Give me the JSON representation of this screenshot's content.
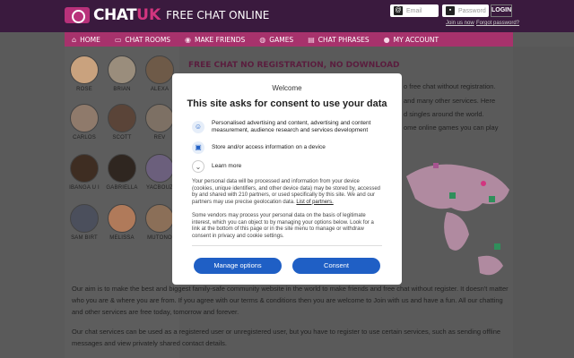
{
  "header": {
    "logo_chat": "CHAT",
    "logo_uk": "UK",
    "logo_tagline": "FREE CHAT ONLINE",
    "email_placeholder": "Email",
    "password_placeholder": "Password",
    "login_label": "LOGIN",
    "join_link": "Join us now",
    "forgot_link": "Forgot password?"
  },
  "nav": {
    "items": [
      {
        "label": "HOME",
        "icon": "home-icon"
      },
      {
        "label": "CHAT ROOMS",
        "icon": "chat-icon"
      },
      {
        "label": "MAKE FRIENDS",
        "icon": "friends-icon"
      },
      {
        "label": "GAMES",
        "icon": "gamepad-icon"
      },
      {
        "label": "CHAT PHRASES",
        "icon": "book-icon"
      },
      {
        "label": "MY ACCOUNT",
        "icon": "user-icon"
      }
    ]
  },
  "friends": [
    {
      "name": "ROSE",
      "color": "#c9a27e"
    },
    {
      "name": "BRIAN",
      "color": "#9a8d7c"
    },
    {
      "name": "ALEXA",
      "color": "#6e5a48"
    },
    {
      "name": "CARLOS",
      "color": "#8f7a6b"
    },
    {
      "name": "SCOTT",
      "color": "#5a4438"
    },
    {
      "name": "REV",
      "color": "#7d7064"
    },
    {
      "name": "IBANGA U I",
      "color": "#3e2d22"
    },
    {
      "name": "GABRIELLA",
      "color": "#2f2620"
    },
    {
      "name": "YACBOUZ",
      "color": "#6b5f7c"
    },
    {
      "name": "SAM BIRT",
      "color": "#4b4f5c"
    },
    {
      "name": "MELISSA",
      "color": "#b07a5a"
    },
    {
      "name": "MUTONO",
      "color": "#8b6f58"
    }
  ],
  "main": {
    "title": "FREE CHAT NO REGISTRATION, NO DOWNLOAD",
    "partial_lines": [
      "o free chat without registration.",
      "and many other services. Here",
      "d singles around the world.",
      "ome online games you can play"
    ],
    "bottom_paragraphs": [
      "Our aim is to make the best and biggest family-safe community website in the world to make friends and free chat without register. It doesn't matter who you are & where you are from. If you agree with our terms & conditions then you are welcome to Join with us and have a fun. All our chatting and other services are free today, tomorrow and forever.",
      "Our chat services can be used as a registered user or unregistered user, but you have to register to use certain services, such as sending offline messages and view privately shared contact details."
    ]
  },
  "consent": {
    "welcome": "Welcome",
    "title": "This site asks for consent to use your data",
    "purposes": [
      {
        "icon": "person-icon",
        "text": "Personalised advertising and content, advertising and content measurement, audience research and services development"
      },
      {
        "icon": "device-icon",
        "text": "Store and/or access information on a device"
      },
      {
        "icon": "chevron-down-icon",
        "text": "Learn more"
      }
    ],
    "para1": "Your personal data will be processed and information from your device (cookies, unique identifiers, and other device data) may be stored by, accessed by and shared with 210 partners, or used specifically by this site. We and our partners may use precise geolocation data.",
    "para1_link": "List of partners.",
    "para2": "Some vendors may process your personal data on the basis of legitimate interest, which you can object to by managing your options below. Look for a link at the bottom of this page or in the site menu to manage or withdraw consent in privacy and cookie settings.",
    "manage_label": "Manage options",
    "consent_label": "Consent"
  },
  "colors": {
    "header_bg": "#3a1a3e",
    "nav_bg": "#a7326c",
    "brand_pink": "#d2357f",
    "button_blue": "#1f5fc5"
  }
}
